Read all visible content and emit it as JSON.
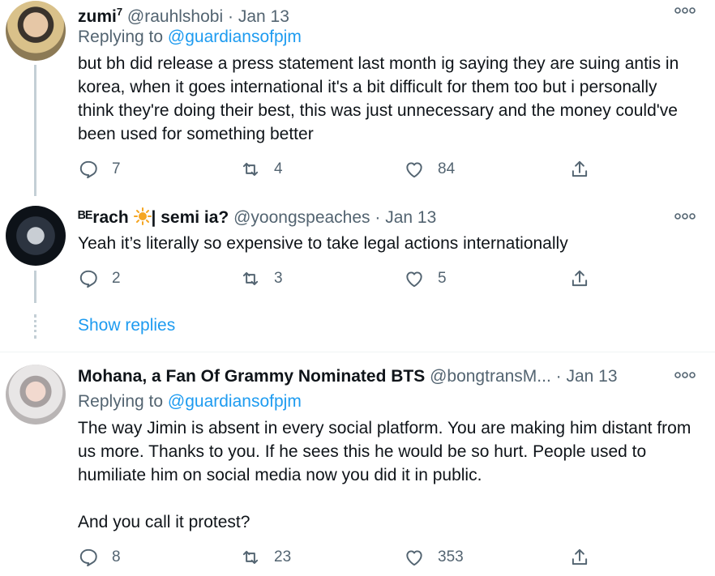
{
  "tweets": [
    {
      "name": "zumi",
      "name_sup": "7",
      "handle": "@rauhlshobi",
      "dot": "·",
      "date": "Jan 13",
      "replying_label": "Replying to",
      "replying_to": "@guardiansofpjm",
      "text": "but bh did release a press statement last month ig saying they are suing antis in korea, when it goes international it's a bit difficult for them too but i personally think they're doing their best, this was just unnecessary and the money could've been used for something better",
      "replies": "7",
      "retweets": "4",
      "likes": "84"
    },
    {
      "name_prefix": "ᴮᴱrach",
      "name_suffix": "| semi ia?",
      "handle": "@yoongspeaches",
      "dot": "·",
      "date": "Jan 13",
      "text": "Yeah it’s literally so expensive to take legal actions internationally",
      "replies": "2",
      "retweets": "3",
      "likes": "5"
    },
    {
      "name": "Mohana, a Fan Of Grammy Nominated BTS",
      "handle": "@bongtransM...",
      "dot": "·",
      "date": "Jan 13",
      "replying_label": "Replying to",
      "replying_to": "@guardiansofpjm",
      "text_p1": "The way Jimin is absent in every social platform. You are making him distant from us more. Thanks to you. If he sees this he would be so hurt. People used to humiliate him on social media now you did it in public.",
      "text_p2": "And you call it protest?",
      "replies": "8",
      "retweets": "23",
      "likes": "353"
    }
  ],
  "show_replies": "Show replies",
  "colors": {
    "accent": "#1d9bf0",
    "secondary_text": "#536471",
    "thread_line": "#c4cfd6",
    "sun": "#f5a623"
  },
  "icons": [
    "avatar",
    "more-icon",
    "reply-icon",
    "retweet-icon",
    "like-icon",
    "share-icon",
    "sun-emoji-icon"
  ]
}
